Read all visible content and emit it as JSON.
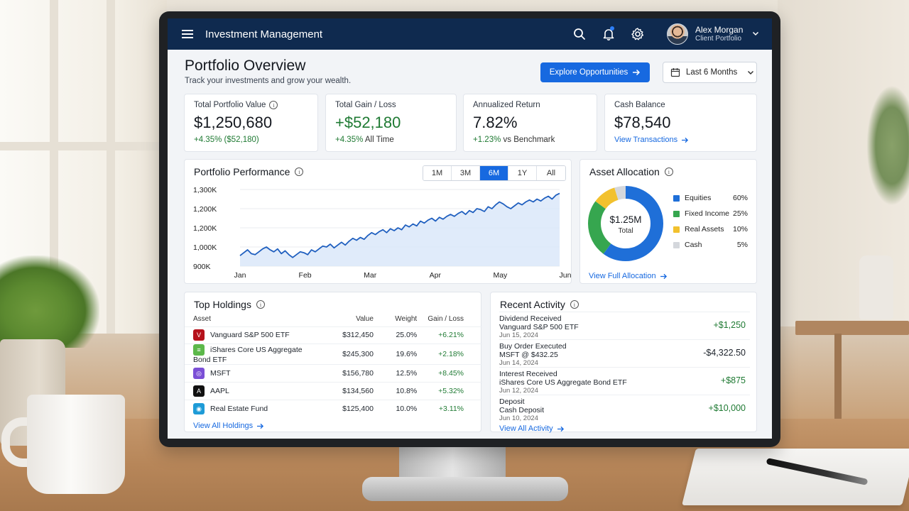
{
  "app": {
    "title": "Investment Management",
    "user_name": "Alex Morgan",
    "user_role": "Client Portfolio",
    "notification_dot": true
  },
  "header": {
    "title": "Portfolio Overview",
    "subtitle": "Track your investments and grow your wealth.",
    "explore_label": "Explore Opportunities",
    "range_label": "Last 6 Months"
  },
  "kpis": {
    "total_value": {
      "label": "Total Portfolio Value",
      "value": "$1,250,680",
      "sub": "+4.35% ($52,180)"
    },
    "gain_loss": {
      "label": "Total Gain / Loss",
      "value": "+$52,180",
      "sub_pct": "+4.35%",
      "sub_text": "All Time"
    },
    "annualized": {
      "label": "Annualized Return",
      "value": "7.82%",
      "sub_pct": "+1.23%",
      "sub_text": "vs Benchmark"
    },
    "cash": {
      "label": "Cash Balance",
      "value": "$78,540",
      "link": "View Transactions"
    }
  },
  "performance": {
    "title": "Portfolio Performance",
    "timeframes": [
      "1M",
      "3M",
      "6M",
      "1Y",
      "All"
    ],
    "active_timeframe": "6M"
  },
  "chart_data": {
    "type": "area",
    "title": "Portfolio Performance",
    "y_ticks": [
      "1,300K",
      "1,200K",
      "1,200K",
      "1,000K",
      "900K"
    ],
    "x_ticks": [
      "Jan",
      "Feb",
      "Mar",
      "Apr",
      "May",
      "Jun"
    ],
    "ylim": [
      900,
      1300
    ],
    "color": "#1f5fbf",
    "fill_color": "#dbe7f9",
    "values": [
      955,
      970,
      985,
      965,
      960,
      975,
      990,
      1000,
      985,
      975,
      990,
      965,
      980,
      960,
      945,
      960,
      975,
      970,
      960,
      985,
      975,
      990,
      1005,
      1000,
      1015,
      995,
      1010,
      1025,
      1010,
      1030,
      1045,
      1035,
      1050,
      1040,
      1060,
      1075,
      1065,
      1080,
      1090,
      1075,
      1095,
      1085,
      1100,
      1090,
      1115,
      1105,
      1120,
      1110,
      1135,
      1125,
      1140,
      1150,
      1135,
      1155,
      1145,
      1160,
      1170,
      1160,
      1175,
      1185,
      1170,
      1190,
      1180,
      1200,
      1195,
      1185,
      1210,
      1200,
      1220,
      1235,
      1225,
      1210,
      1200,
      1215,
      1230,
      1220,
      1235,
      1245,
      1235,
      1250,
      1240,
      1255,
      1265,
      1250,
      1270,
      1280
    ]
  },
  "allocation": {
    "title": "Asset Allocation",
    "center_value": "$1.25M",
    "center_label": "Total",
    "link": "View Full Allocation",
    "items": [
      {
        "name": "Equities",
        "pct": "60%",
        "value": 60,
        "color": "#1f6fd8"
      },
      {
        "name": "Fixed Income",
        "pct": "25%",
        "value": 25,
        "color": "#36a64f"
      },
      {
        "name": "Real Assets",
        "pct": "10%",
        "value": 10,
        "color": "#f2c12e"
      },
      {
        "name": "Cash",
        "pct": "5%",
        "value": 5,
        "color": "#d4d7dc"
      }
    ]
  },
  "holdings": {
    "title": "Top Holdings",
    "columns": [
      "Asset",
      "Value",
      "Weight",
      "Gain / Loss"
    ],
    "rows": [
      {
        "asset": "Vanguard S&P 500 ETF",
        "value": "$312,450",
        "weight": "25.0%",
        "gain": "+6.21%",
        "icon": "vanguard-icon",
        "icon_color": "#b5121b",
        "icon_glyph": "V"
      },
      {
        "asset": "iShares Core US Aggregate Bond ETF",
        "value": "$245,300",
        "weight": "19.6%",
        "gain": "+2.18%",
        "icon": "ishares-icon",
        "icon_color": "#5cb84a",
        "icon_glyph": "≡"
      },
      {
        "asset": "MSFT",
        "value": "$156,780",
        "weight": "12.5%",
        "gain": "+8.45%",
        "icon": "msft-icon",
        "icon_color": "#7b4fd6",
        "icon_glyph": "◎"
      },
      {
        "asset": "AAPL",
        "value": "$134,560",
        "weight": "10.8%",
        "gain": "+5.32%",
        "icon": "aapl-icon",
        "icon_color": "#111111",
        "icon_glyph": "A"
      },
      {
        "asset": "Real Estate Fund",
        "value": "$125,400",
        "weight": "10.0%",
        "gain": "+3.11%",
        "icon": "real-estate-icon",
        "icon_color": "#1e9bd7",
        "icon_glyph": "◉"
      }
    ],
    "link": "View All Holdings"
  },
  "activity": {
    "title": "Recent Activity",
    "items": [
      {
        "type": "Dividend Received",
        "detail": "Vanguard S&P 500 ETF",
        "date": "Jun 15, 2024",
        "amount": "+$1,250",
        "positive": true
      },
      {
        "type": "Buy Order Executed",
        "detail": "MSFT @ $432.25",
        "date": "Jun 14, 2024",
        "amount": "-$4,322.50",
        "positive": false
      },
      {
        "type": "Interest Received",
        "detail": "iShares Core US Aggregate Bond ETF",
        "date": "Jun 12, 2024",
        "amount": "+$875",
        "positive": true
      },
      {
        "type": "Deposit",
        "detail": "Cash Deposit",
        "date": "Jun 10, 2024",
        "amount": "+$10,000",
        "positive": true
      }
    ],
    "link": "View All Activity"
  }
}
